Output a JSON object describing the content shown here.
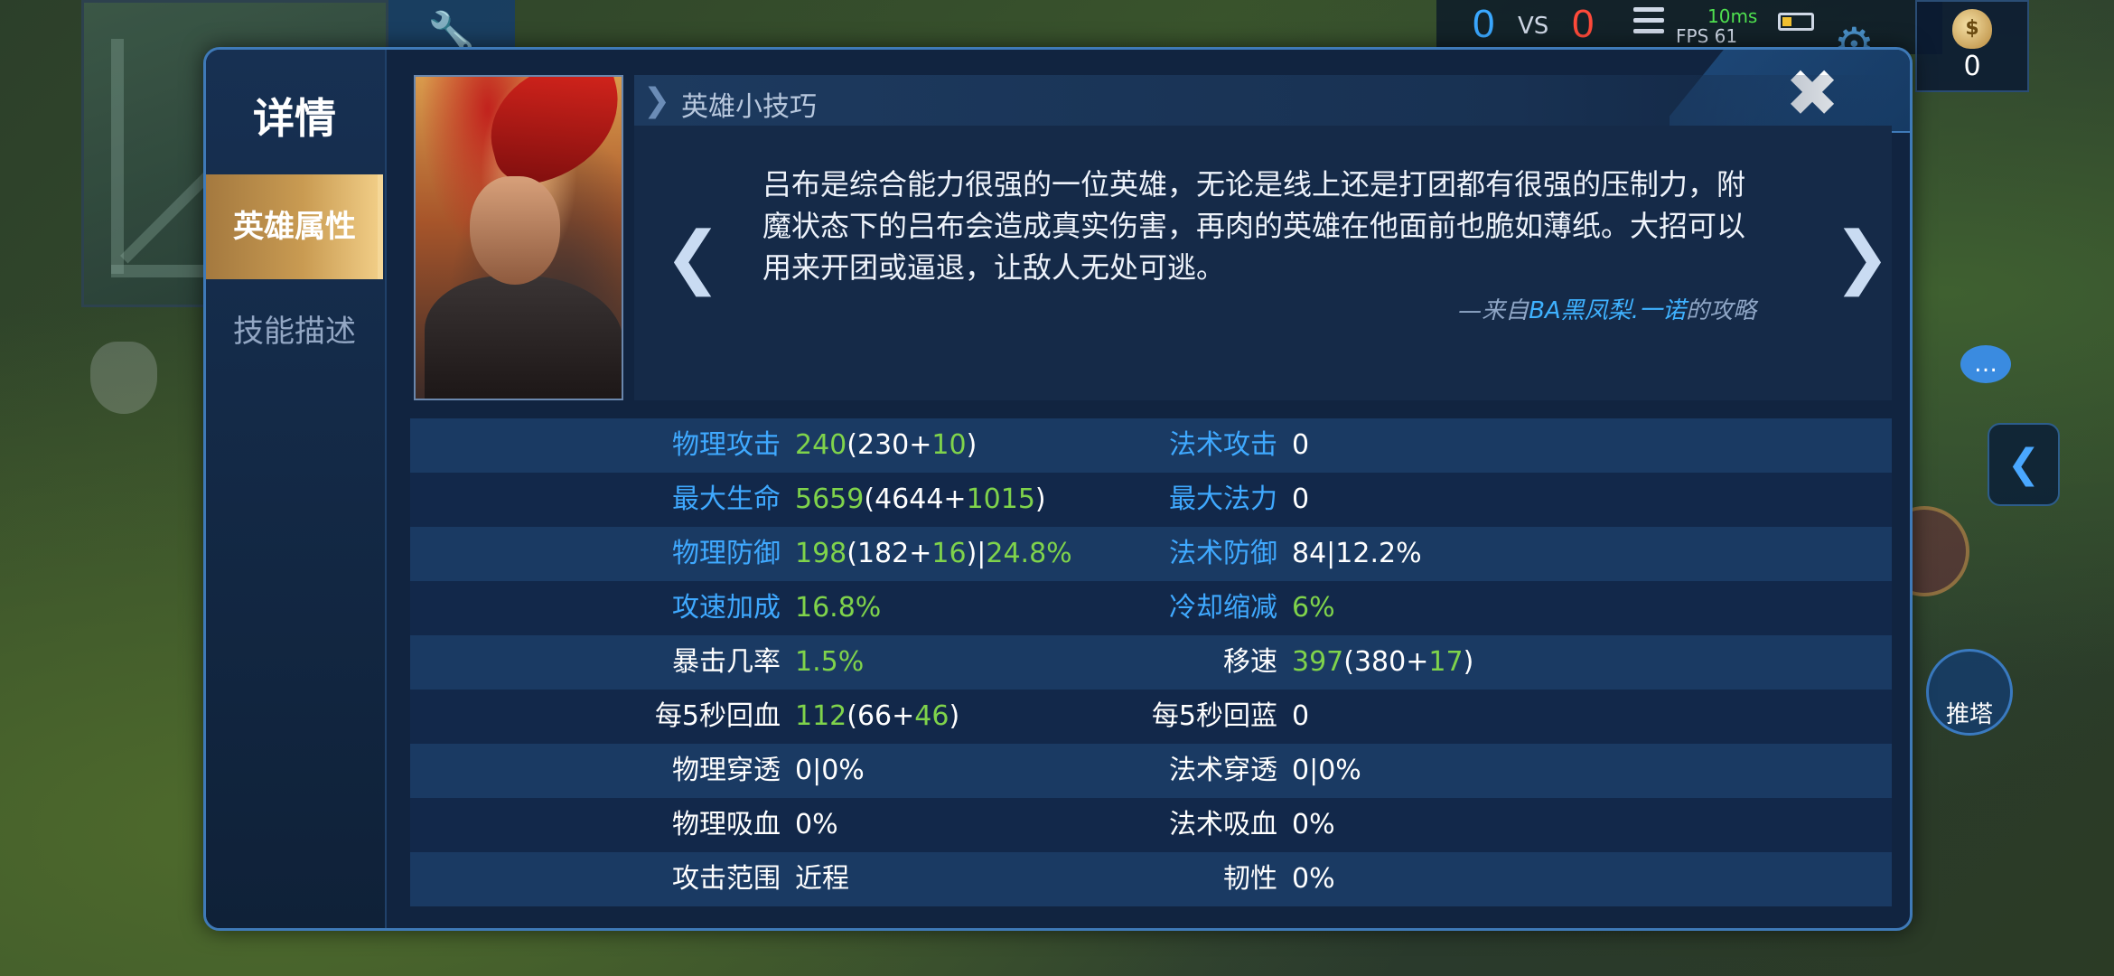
{
  "hud": {
    "score_blue": "0",
    "vs": "VS",
    "score_red": "0",
    "ping": "10ms",
    "fps": "FPS 61",
    "gold_icon": "$",
    "gold": "0",
    "tower_button": "推塔"
  },
  "sidebar": {
    "title": "详情",
    "tabs": [
      {
        "label": "英雄属性",
        "active": true
      },
      {
        "label": "技能描述",
        "active": false
      }
    ]
  },
  "tip": {
    "title": "英雄小技巧",
    "text": "吕布是综合能力很强的一位英雄，无论是线上还是打团都有很强的压制力，附魔状态下的吕布会造成真实伤害，再肉的英雄在他面前也脆如薄纸。大招可以用来开团或逼退，让敌人无处可逃。",
    "source_prefix": "—来自",
    "source_author": "BA黑凤梨.一诺",
    "source_suffix": "的攻略"
  },
  "icons": {
    "close": "close-icon",
    "prev": "chevron-left-icon",
    "next": "chevron-right-icon"
  },
  "colors": {
    "accent_blue": "#3fa9ff",
    "bonus_green": "#7fd34b",
    "active_tab_gold": "#c99b52"
  },
  "stats": [
    {
      "left_label": "物理攻击",
      "left_value": [
        [
          "g",
          "240"
        ],
        [
          "w",
          "(230+"
        ],
        [
          "g",
          "10"
        ],
        [
          "w",
          ")"
        ]
      ],
      "left_label_color": "blue",
      "right_label": "法术攻击",
      "right_value": [
        [
          "w",
          "0"
        ]
      ],
      "right_label_color": "blue"
    },
    {
      "left_label": "最大生命",
      "left_value": [
        [
          "g",
          "5659"
        ],
        [
          "w",
          "(4644+"
        ],
        [
          "g",
          "1015"
        ],
        [
          "w",
          ")"
        ]
      ],
      "left_label_color": "blue",
      "right_label": "最大法力",
      "right_value": [
        [
          "w",
          "0"
        ]
      ],
      "right_label_color": "blue"
    },
    {
      "left_label": "物理防御",
      "left_value": [
        [
          "g",
          "198"
        ],
        [
          "w",
          "(182+"
        ],
        [
          "g",
          "16"
        ],
        [
          "w",
          ")|"
        ],
        [
          "g",
          "24.8%"
        ]
      ],
      "left_label_color": "blue",
      "right_label": "法术防御",
      "right_value": [
        [
          "w",
          "84|12.2%"
        ]
      ],
      "right_label_color": "blue"
    },
    {
      "left_label": "攻速加成",
      "left_value": [
        [
          "g",
          "16.8%"
        ]
      ],
      "left_label_color": "blue",
      "right_label": "冷却缩减",
      "right_value": [
        [
          "g",
          "6%"
        ]
      ],
      "right_label_color": "blue"
    },
    {
      "left_label": "暴击几率",
      "left_value": [
        [
          "g",
          "1.5%"
        ]
      ],
      "left_label_color": "white",
      "right_label": "移速",
      "right_value": [
        [
          "g",
          "397"
        ],
        [
          "w",
          "(380+"
        ],
        [
          "g",
          "17"
        ],
        [
          "w",
          ")"
        ]
      ],
      "right_label_color": "white"
    },
    {
      "left_label": "每5秒回血",
      "left_value": [
        [
          "g",
          "112"
        ],
        [
          "w",
          "(66+"
        ],
        [
          "g",
          "46"
        ],
        [
          "w",
          ")"
        ]
      ],
      "left_label_color": "white",
      "right_label": "每5秒回蓝",
      "right_value": [
        [
          "w",
          "0"
        ]
      ],
      "right_label_color": "white"
    },
    {
      "left_label": "物理穿透",
      "left_value": [
        [
          "w",
          "0|0%"
        ]
      ],
      "left_label_color": "white",
      "right_label": "法术穿透",
      "right_value": [
        [
          "w",
          "0|0%"
        ]
      ],
      "right_label_color": "white"
    },
    {
      "left_label": "物理吸血",
      "left_value": [
        [
          "w",
          "0%"
        ]
      ],
      "left_label_color": "white",
      "right_label": "法术吸血",
      "right_value": [
        [
          "w",
          "0%"
        ]
      ],
      "right_label_color": "white"
    },
    {
      "left_label": "攻击范围",
      "left_value": [
        [
          "w",
          "近程"
        ]
      ],
      "left_label_color": "white",
      "right_label": "韧性",
      "right_value": [
        [
          "w",
          "0%"
        ]
      ],
      "right_label_color": "white"
    }
  ]
}
